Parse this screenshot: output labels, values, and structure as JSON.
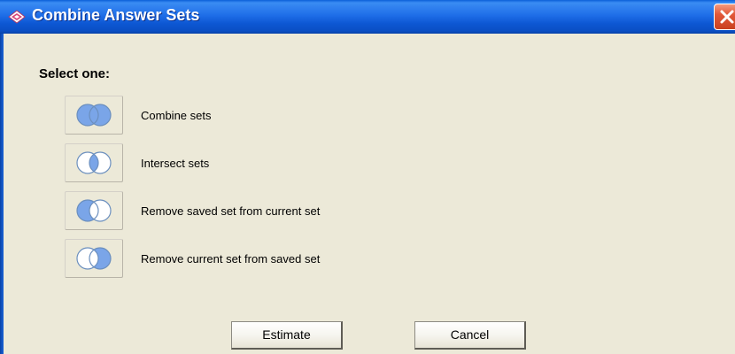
{
  "window": {
    "title": "Combine Answer Sets",
    "app_icon": "app-logo-icon",
    "close_icon": "close-icon"
  },
  "dialog": {
    "select_label": "Select one:",
    "options": [
      {
        "label": "Combine sets",
        "icon": "union-venn-icon"
      },
      {
        "label": "Intersect sets",
        "icon": "intersection-venn-icon"
      },
      {
        "label": "Remove saved set from current set",
        "icon": "left-difference-venn-icon"
      },
      {
        "label": "Remove current set from saved set",
        "icon": "right-difference-venn-icon"
      }
    ],
    "buttons": {
      "estimate": "Estimate",
      "cancel": "Cancel"
    }
  },
  "colors": {
    "titlebar": "#1f6ee8",
    "dialog_bg": "#ece9d8",
    "close_button": "#e2593a",
    "venn_fill": "#7aa5e8",
    "venn_outline": "#6b8fbe"
  }
}
